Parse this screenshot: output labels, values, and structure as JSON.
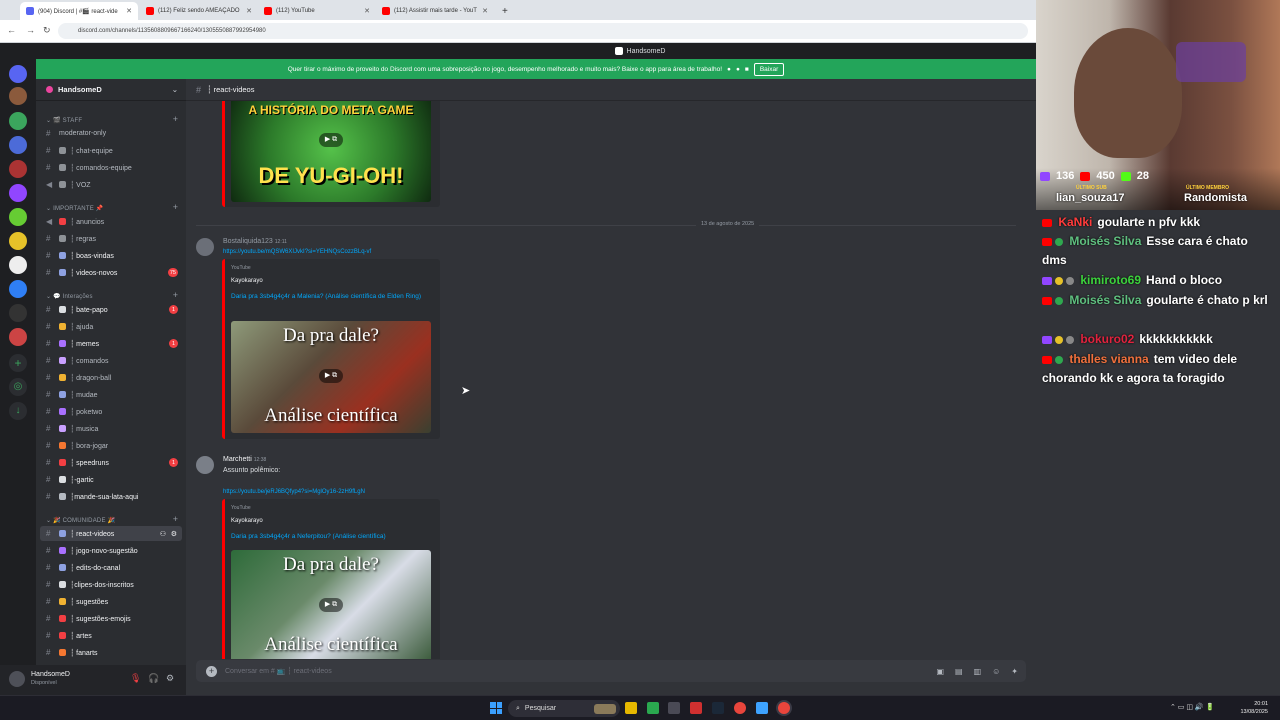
{
  "browser": {
    "tabs": [
      {
        "label": "(904) Discord | #🎬 react-vide",
        "active": true,
        "favicon": "discord-icon",
        "color": "#5865f2"
      },
      {
        "label": "(112) Feliz sendo AMEAÇADO",
        "active": false,
        "favicon": "youtube-icon",
        "color": "#ff0000"
      },
      {
        "label": "(112) YouTube",
        "active": false,
        "favicon": "youtube-icon",
        "color": "#ff0000"
      },
      {
        "label": "(112) Assistir mais tarde - YouT",
        "active": false,
        "favicon": "youtube-icon",
        "color": "#ff0000"
      }
    ],
    "new_tab": "+",
    "url": "discord.com/channels/1135608809667166240/1305550887992954980"
  },
  "discord": {
    "window_title": "HandsomeD",
    "banner": {
      "text": "Quer tirar o máximo de proveito do Discord com uma sobreposição no jogo, desempenho melhorado e muito mais? Baixe o app para área de trabalho!",
      "button": "Baixar"
    },
    "server_name": "HandsomeD",
    "categories": [
      {
        "label": "STAFF"
      },
      {
        "label": "IMPORTANTE"
      },
      {
        "label": "Interações"
      },
      {
        "label": "COMUNIDADE"
      }
    ],
    "channels": [
      {
        "label": "moderator-only",
        "emoji": "",
        "badge": ""
      },
      {
        "label": "┆ chat-equipe",
        "emoji": "#8e9297",
        "badge": ""
      },
      {
        "label": "┆ comandos-equipe",
        "emoji": "#8e9297",
        "badge": ""
      },
      {
        "label": "┆ VOZ",
        "emoji": "#8e9297",
        "badge": ""
      },
      {
        "label": "┆ anuncios",
        "emoji": "#8e9297",
        "badge": ""
      },
      {
        "label": "┆ regras",
        "emoji": "#8e9297",
        "badge": ""
      },
      {
        "label": "┆ boas-vindas",
        "emoji": "#8ea1e1",
        "badge": ""
      },
      {
        "label": "┆ videos-novos",
        "emoji": "#8ea1e1",
        "badge": "75"
      },
      {
        "label": "┆ bate-papo",
        "emoji": "#dbdee1",
        "badge": "1"
      },
      {
        "label": "┆ ajuda",
        "emoji": "#f0b232",
        "badge": ""
      },
      {
        "label": "┆ memes",
        "emoji": "#a970ff",
        "badge": "1"
      },
      {
        "label": "┆ comandos",
        "emoji": "#c9a0ff",
        "badge": ""
      },
      {
        "label": "┆ dragon-ball",
        "emoji": "#f0b232",
        "badge": ""
      },
      {
        "label": "┆ mudae",
        "emoji": "#8ea1e1",
        "badge": ""
      },
      {
        "label": "┆ poketwo",
        "emoji": "#a970ff",
        "badge": ""
      },
      {
        "label": "┆ musica",
        "emoji": "#c9a0ff",
        "badge": ""
      },
      {
        "label": "┆ bora-jogar",
        "emoji": "#f57731",
        "badge": ""
      },
      {
        "label": "┆ speedruns",
        "emoji": "#f23f43",
        "badge": "1"
      },
      {
        "label": "┆-gartic",
        "emoji": "#dbdee1",
        "badge": ""
      },
      {
        "label": "┆mande-sua-lata-aqui",
        "emoji": "#b5bac1",
        "badge": ""
      },
      {
        "label": "┆ react-videos",
        "emoji": "#8ea1e1",
        "badge": ""
      },
      {
        "label": "┆ jogo-novo-sugestão",
        "emoji": "#a970ff",
        "badge": ""
      },
      {
        "label": "┆ edits-do-canal",
        "emoji": "#8ea1e1",
        "badge": ""
      },
      {
        "label": "┆clipes-dos-inscritos",
        "emoji": "#dbdee1",
        "badge": ""
      },
      {
        "label": "┆ sugestões",
        "emoji": "#f0b232",
        "badge": ""
      },
      {
        "label": "┆ sugestões-emojis",
        "emoji": "#f23f43",
        "badge": ""
      },
      {
        "label": "┆ artes",
        "emoji": "#f23f43",
        "badge": ""
      },
      {
        "label": "┆ fanarts",
        "emoji": "#f57731",
        "badge": ""
      }
    ],
    "current_channel": "┆ react-videos",
    "user": {
      "name": "HandsomeD",
      "status": "Disponível"
    },
    "date_divider": "13 de agosto de 2025",
    "messages": [
      {
        "thumb_top": "A HISTÓRIA DO META GAME",
        "thumb_bottom": "DE YU-GI-OH!"
      },
      {
        "author": "Bostaliquida123",
        "time": "12:11",
        "link": "https://youtu.be/mQSW6XIJvkI?si=YEHNQsCozzBLq-vf",
        "provider": "YouTube",
        "channel": "Kayokarayo",
        "title": "Daria pra 3sb4g4ç4r a Malenia? (Análise científica de Elden Ring)",
        "thumb_top": "Da pra dale?",
        "thumb_bottom": "Análise científica"
      },
      {
        "author": "Marchetti",
        "time": "12:38",
        "text": "Assunto polêmico:",
        "link": "https://youtu.be/jeRJ6BQfyp4?si=MglOy16-2zH9fLgN",
        "provider": "YouTube",
        "channel": "Kayokarayo",
        "title": "Daria pra 3sb4g4ç4r a Neferpitou? (Análise científica)",
        "thumb_top": "Da pra dale?",
        "thumb_bottom": "Análise científica"
      }
    ],
    "composer_placeholder": "Conversar em # 📺 ┆ react-videos"
  },
  "taskbar": {
    "search": "Pesquisar",
    "time": "20:01",
    "date": "13/08/2025"
  },
  "stream_overlay": {
    "stats": {
      "subs": "136",
      "youtube": "450",
      "kick": "28"
    },
    "last_sub_label": "ÚLTIMO SUB",
    "last_sub": "lian_souza17",
    "last_member_label": "ÚLTIMO MEMBRO",
    "last_member": "Randomista",
    "chat": [
      {
        "platform": "youtube",
        "user": "KaNki",
        "user_color": "#ff3b3b",
        "msg": "goularte n pfv kkk"
      },
      {
        "platform": "youtube",
        "user": "Moisés Silva",
        "user_color": "#5fbf7f",
        "msg": "Esse cara é chato dms"
      },
      {
        "platform": "twitch",
        "user": "kimiroto69",
        "user_color": "#3cd23c",
        "msg": "Hand o bloco"
      },
      {
        "platform": "youtube",
        "user": "Moisés Silva",
        "user_color": "#5fbf7f",
        "msg": "goularte é chato p krl"
      },
      {
        "platform": "twitch",
        "user": "bokuro02",
        "user_color": "#e0233e",
        "msg": "kkkkkkkkkkk"
      },
      {
        "platform": "youtube",
        "user": "thalles vianna",
        "user_color": "#f0703c",
        "msg": "tem video dele chorando kk e agora ta foragido"
      }
    ]
  }
}
